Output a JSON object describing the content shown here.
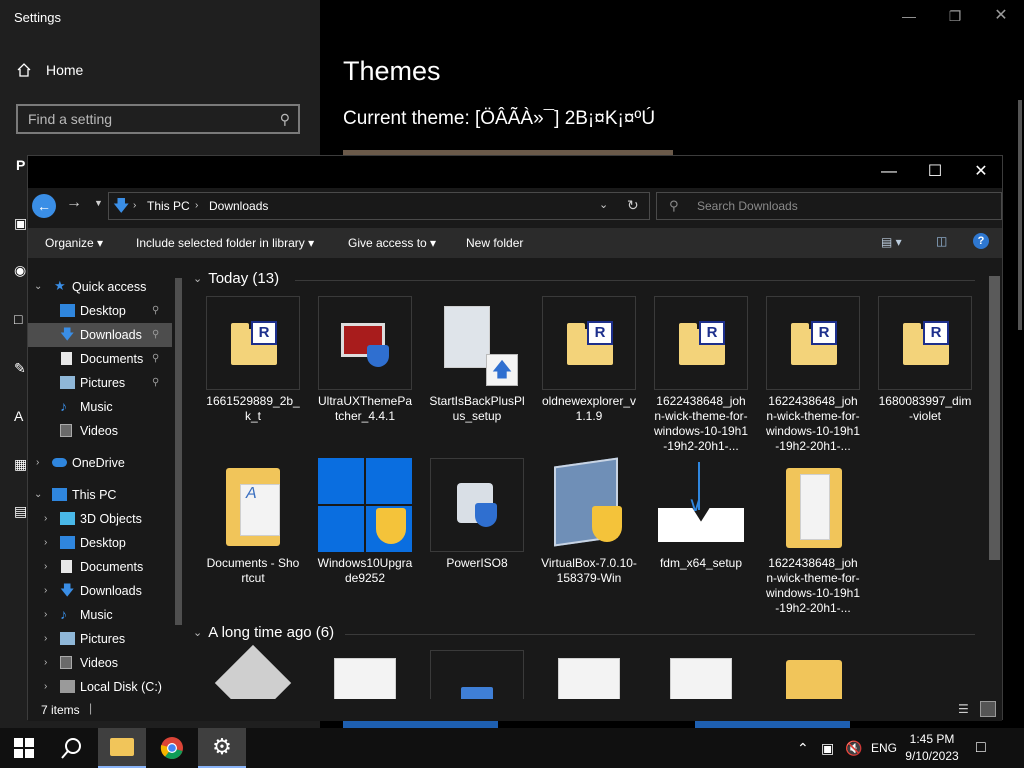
{
  "settings": {
    "title": "Settings",
    "home_label": "Home",
    "search_placeholder": "Find a setting",
    "page_heading": "Themes",
    "current_theme": "Current theme: [ÖÂÃÀ»¯] 2B¡¤K¡¤ºÚ",
    "partial_section_letter": "P"
  },
  "explorer": {
    "breadcrumb": [
      "This PC",
      "Downloads"
    ],
    "search_placeholder": "Search Downloads",
    "commands": {
      "organize": "Organize",
      "include": "Include selected folder in library",
      "give_access": "Give access to",
      "new_folder": "New folder"
    },
    "nav": {
      "quick_access": "Quick access",
      "quick_items": [
        "Desktop",
        "Downloads",
        "Documents",
        "Pictures",
        "Music",
        "Videos"
      ],
      "onedrive": "OneDrive",
      "this_pc": "This PC",
      "pc_items": [
        "3D Objects",
        "Desktop",
        "Documents",
        "Downloads",
        "Music",
        "Pictures",
        "Videos",
        "Local Disk (C:)"
      ]
    },
    "groups": [
      {
        "heading": "Today (13)",
        "items": [
          "1661529889_2b_k_t",
          "UltraUXThemePatcher_4.4.1",
          "StartIsBackPlusPlus_setup",
          "oldnewexplorer_v1.1.9",
          "1622438648_john-wick-theme-for-windows-10-19h1-19h2-20h1-...",
          "1622438648_john-wick-theme-for-windows-10-19h1-19h2-20h1-...",
          "1680083997_dim-violet",
          "Documents - Shortcut",
          "Windows10Upgrade9252",
          "PowerISO8",
          "VirtualBox-7.0.10-158379-Win",
          "fdm_x64_setup",
          "1622438648_john-wick-theme-for-windows-10-19h1-19h2-20h1-..."
        ]
      },
      {
        "heading": "A long time ago (6)"
      }
    ],
    "status": "7 items"
  },
  "taskbar": {
    "lang": "ENG",
    "time": "1:45 PM",
    "date": "9/10/2023"
  }
}
